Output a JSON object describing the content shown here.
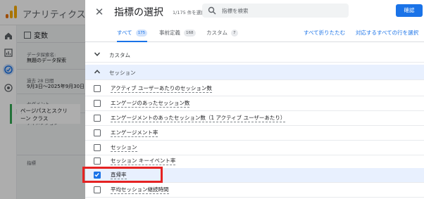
{
  "background_app": {
    "app_name": "アナリティクス",
    "panel_title": "変数",
    "exploration_name_label": "データ探索名:",
    "exploration_name": "無題のデータ探索",
    "date_range_label": "過去 28 日間",
    "date_range": "9月3日～2025年9月30日",
    "segments_label": "セグメント",
    "dimensions_label": "ディメンション",
    "dimension_item_line1": "ページパスとスクリ",
    "dimension_item_line2": "ーン クラス",
    "metrics_label": "指標",
    "colors": {
      "logo_orange": "#e8710a",
      "logo_yellow": "#f9ab00",
      "active_nav": "#1a73e8"
    }
  },
  "dialog": {
    "title": "指標の選択",
    "selected_count": "1/175 件を選択中",
    "search": {
      "placeholder": "指標を検索",
      "value": ""
    },
    "confirm_label": "確認",
    "tabs": [
      {
        "label": "すべて",
        "count": "175",
        "active": true
      },
      {
        "label": "事前定義",
        "count": "168",
        "active": false
      },
      {
        "label": "カスタム",
        "count": "7",
        "active": false
      }
    ],
    "collapse_all_label": "すべて折りたたむ",
    "select_all_label": "対応するすべての行を選択",
    "groups": [
      {
        "label": "カスタム",
        "expanded": false
      },
      {
        "label": "セッション",
        "expanded": true
      }
    ],
    "metrics": [
      {
        "label": "アクティブ ユーザーあたりのセッション数",
        "checked": false
      },
      {
        "label": "エンゲージのあったセッション数",
        "checked": false
      },
      {
        "label": "エンゲージメントのあったセッション数（1 アクティブ ユーザーあたり）",
        "checked": false
      },
      {
        "label": "エンゲージメント率",
        "checked": false
      },
      {
        "label": "セッション",
        "checked": false
      },
      {
        "label": "セッション キーイベント率",
        "checked": false
      },
      {
        "label": "直帰率",
        "checked": true
      },
      {
        "label": "平均セッション継続時間",
        "checked": false
      }
    ],
    "colors": {
      "accent": "#1a73e8",
      "highlight": "#e52222",
      "selected_row": "#e8f0fe"
    }
  }
}
